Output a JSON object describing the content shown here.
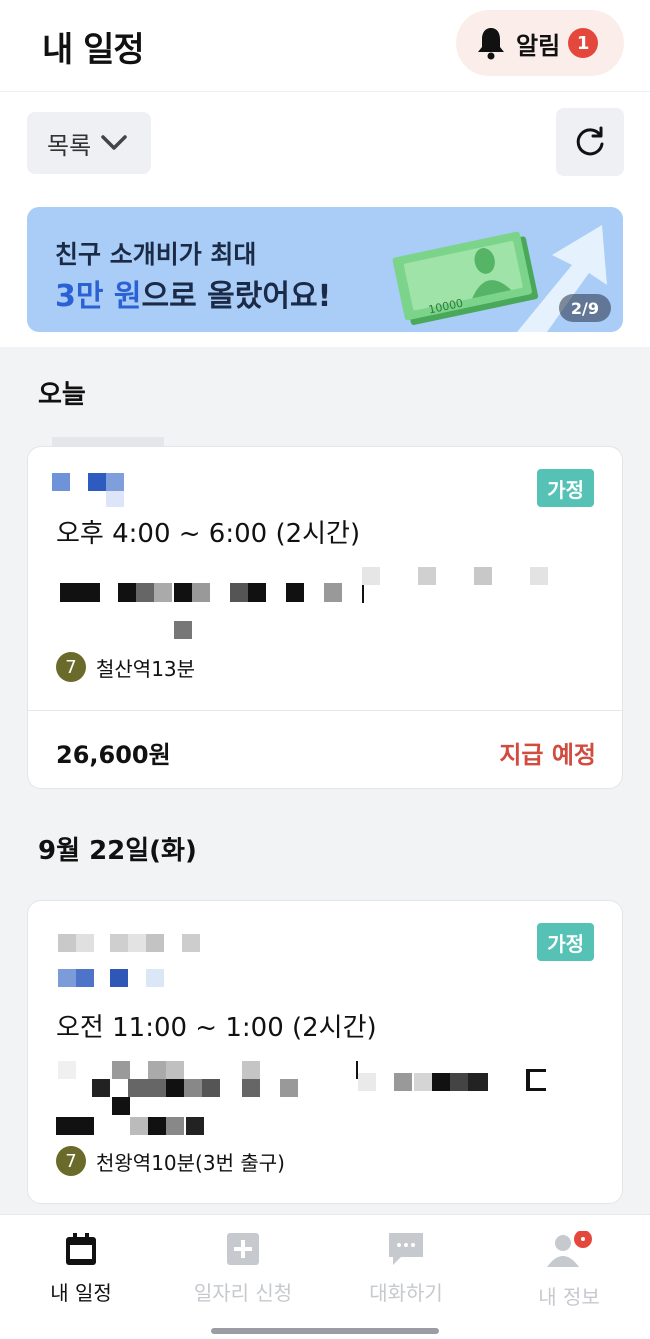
{
  "header": {
    "title": "내 일정",
    "alarm_label": "알림",
    "alarm_count": "1"
  },
  "toolbar": {
    "view_label": "목록"
  },
  "banner": {
    "line1": "친구 소개비가 최대",
    "line2_highlight": "3만 원",
    "line2_rest": "으로 올랐어요!",
    "bill_text": "10000",
    "page_indicator": "2/9"
  },
  "sections": [
    {
      "title": "오늘",
      "card": {
        "tag": "가정",
        "time": "오후 4:00 ~ 6:00 (2시간)",
        "station_line": "7",
        "station": "철산역13분",
        "amount": "26,600원",
        "status": "지급 예정"
      }
    },
    {
      "title": "9월 22일(화)",
      "card": {
        "tag": "가정",
        "time": "오전 11:00 ~ 1:00 (2시간)",
        "station_line": "7",
        "station": "천왕역10분(3번 출구)"
      }
    }
  ],
  "tabbar": {
    "tabs": [
      {
        "label": "내 일정",
        "icon": "calendar-icon"
      },
      {
        "label": "일자리 신청",
        "icon": "plus-icon"
      },
      {
        "label": "대화하기",
        "icon": "chat-icon"
      },
      {
        "label": "내 정보",
        "icon": "user-icon"
      }
    ]
  },
  "colors": {
    "accent_blue": "#2a62d6",
    "tag_teal": "#55c2b5",
    "status_red": "#d14b3f",
    "alarm_red": "#e4483d",
    "line7_olive": "#6a6a2a",
    "banner_bg": "#a9cdf7"
  }
}
